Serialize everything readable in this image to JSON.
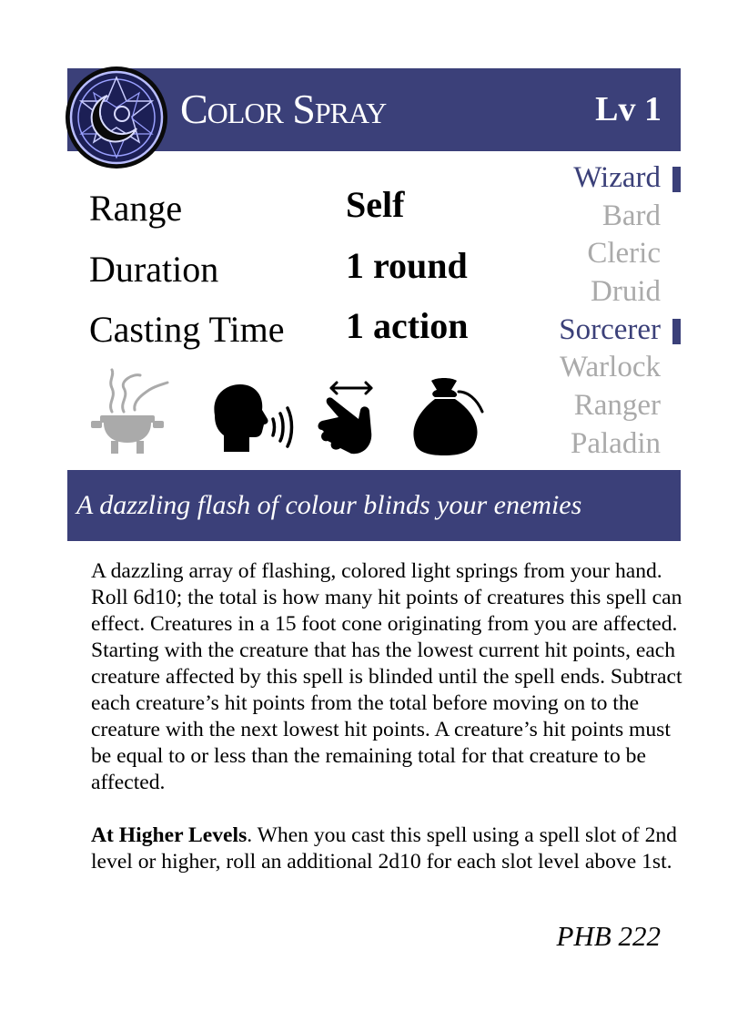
{
  "card": {
    "title": "Color Spray",
    "level": "Lv 1",
    "tagline": "A dazzling flash of colour blinds your enemies",
    "source": "PHB 222"
  },
  "stats": {
    "range_label": "Range",
    "range_value": "Self",
    "duration_label": "Duration",
    "duration_value": "1 round",
    "casting_label": "Casting Time",
    "casting_value": "1 action"
  },
  "classes": [
    {
      "name": "Wizard",
      "active": true
    },
    {
      "name": "Bard",
      "active": false
    },
    {
      "name": "Cleric",
      "active": false
    },
    {
      "name": "Druid",
      "active": false
    },
    {
      "name": "Sorcerer",
      "active": true
    },
    {
      "name": "Warlock",
      "active": false
    },
    {
      "name": "Ranger",
      "active": false
    },
    {
      "name": "Paladin",
      "active": false
    }
  ],
  "components": [
    {
      "icon": "ritual-brazier-icon",
      "active": false
    },
    {
      "icon": "verbal-speaking-head-icon",
      "active": true
    },
    {
      "icon": "somatic-hand-gesture-icon",
      "active": true
    },
    {
      "icon": "material-pouch-icon",
      "active": true
    }
  ],
  "description": {
    "paragraph1": "A dazzling array of flashing, colored light springs from your hand. Roll 6d10; the total is how many hit points of creatures this spell can effect. Creatures in a 15 foot cone originating from you are affected. Starting with the creature that has the lowest current hit points, each creature affected by this spell is blinded until the spell ends. Subtract each creature’s hit points from the total before moving on to the creature with the next lowest hit points. A creature’s hit points must be equal to or less than the remaining total for that creature to be affected.",
    "higher_levels_label": "At Higher Levels",
    "higher_levels_text": ". When you cast this spell using a spell slot of 2nd level or higher, roll an additional 2d10 for each slot level above 1st."
  },
  "colors": {
    "accent": "#3b4079",
    "inactive": "#aaaaaa",
    "seal_glow": "#9aa0ff"
  }
}
